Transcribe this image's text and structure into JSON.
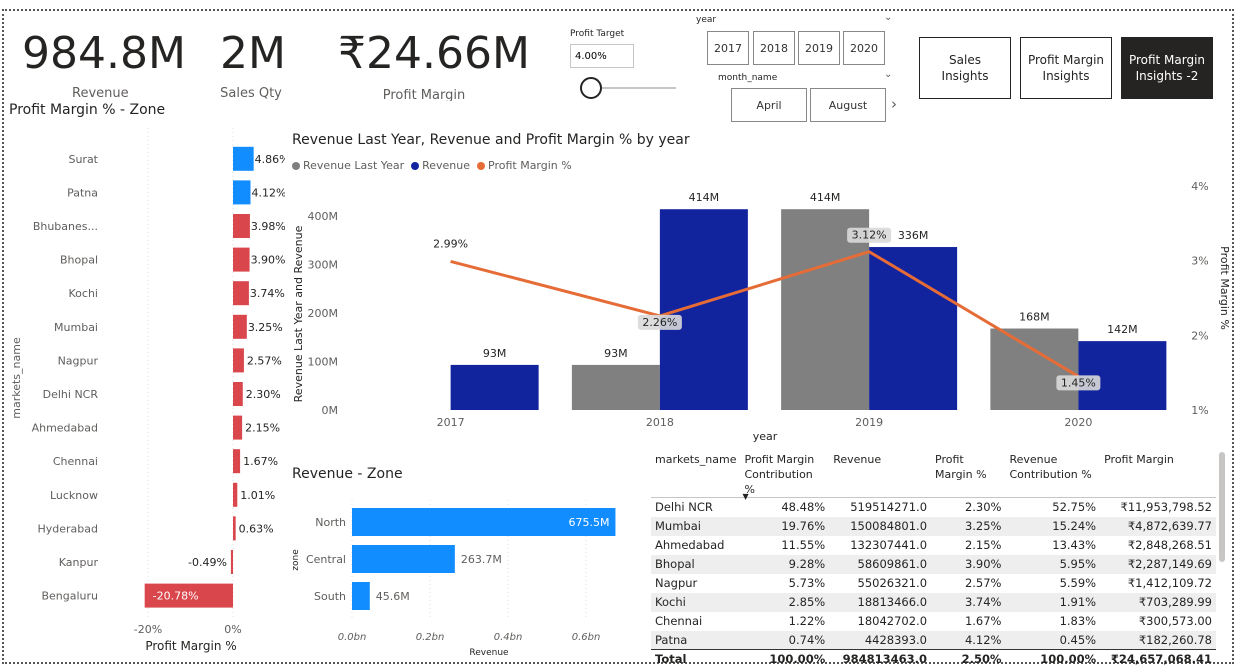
{
  "kpis": [
    {
      "value": "984.8M",
      "label": "Revenue"
    },
    {
      "value": "2M",
      "label": "Sales Qty"
    },
    {
      "value": "₹24.66M",
      "label": "Profit Margin"
    }
  ],
  "profit_target": {
    "label": "Profit Target",
    "value": "4.00%"
  },
  "year_slicer": {
    "label": "year",
    "items": [
      "2017",
      "2018",
      "2019",
      "2020"
    ]
  },
  "month_slicer": {
    "label": "month_name",
    "items": [
      "April",
      "August"
    ]
  },
  "nav_buttons": [
    {
      "label": "Sales Insights"
    },
    {
      "label": "Profit Margin Insights"
    },
    {
      "label": "Profit Margin Insights -2"
    }
  ],
  "colors": {
    "blue": "#118dff",
    "red": "#d9464c",
    "dark_blue": "#12239e",
    "gray": "#808080",
    "orange": "#e66c37",
    "dark_button": "#252423"
  },
  "zone_margin_chart": {
    "title": "Profit Margin % - Zone",
    "y_axis_label": "markets_name",
    "x_axis_label": "Profit Margin %",
    "x_ticks": [
      "-20%",
      "0%"
    ]
  },
  "combo_chart": {
    "title": "Revenue Last Year, Revenue and Profit Margin % by year",
    "legend": [
      "Revenue Last Year",
      "Revenue",
      "Profit Margin %"
    ],
    "y_axis_label": "Revenue Last Year and Revenue",
    "y2_axis_label": "Profit Margin %",
    "x_axis_label": "year",
    "y_ticks": [
      "0M",
      "100M",
      "200M",
      "300M",
      "400M"
    ],
    "y2_ticks": [
      "1%",
      "2%",
      "3%",
      "4%"
    ]
  },
  "revenue_zone_chart": {
    "title": "Revenue - Zone",
    "y_axis_label": "zone",
    "x_axis_label": "Revenue",
    "x_ticks": [
      "0.0bn",
      "0.2bn",
      "0.4bn",
      "0.6bn"
    ]
  },
  "chart_data": [
    {
      "type": "bar",
      "title": "Profit Margin % - Zone",
      "orientation": "horizontal",
      "categories": [
        "Surat",
        "Patna",
        "Bhubanes...",
        "Bhopal",
        "Kochi",
        "Mumbai",
        "Nagpur",
        "Delhi NCR",
        "Ahmedabad",
        "Chennai",
        "Lucknow",
        "Hyderabad",
        "Kanpur",
        "Bengaluru"
      ],
      "values": [
        4.86,
        4.12,
        3.98,
        3.9,
        3.74,
        3.25,
        2.57,
        2.3,
        2.15,
        1.67,
        1.01,
        0.63,
        -0.49,
        -20.78
      ],
      "labels": [
        "4.86%",
        "4.12%",
        "3.98%",
        "3.90%",
        "3.74%",
        "3.25%",
        "2.57%",
        "2.30%",
        "2.15%",
        "1.67%",
        "1.01%",
        "0.63%",
        "-0.49%",
        "-20.78%"
      ],
      "xlabel": "Profit Margin %",
      "ylabel": "markets_name",
      "xlim": [
        -24,
        6
      ]
    },
    {
      "type": "bar",
      "title": "Revenue Last Year, Revenue and Profit Margin % by year",
      "categories": [
        "2017",
        "2018",
        "2019",
        "2020"
      ],
      "series": [
        {
          "name": "Revenue Last Year",
          "values": [
            null,
            93,
            414,
            168
          ],
          "labels": [
            "",
            "93M",
            "414M",
            "168M"
          ]
        },
        {
          "name": "Revenue",
          "values": [
            93,
            414,
            336,
            142
          ],
          "labels": [
            "93M",
            "414M",
            "336M",
            "142M"
          ]
        },
        {
          "name": "Profit Margin %",
          "type": "line",
          "axis": "secondary",
          "values": [
            2.99,
            2.26,
            3.12,
            1.45
          ],
          "labels": [
            "2.99%",
            "2.26%",
            "3.12%",
            "1.45%"
          ]
        }
      ],
      "xlabel": "year",
      "ylabel": "Revenue Last Year and Revenue",
      "y2label": "Profit Margin %",
      "ylim": [
        0,
        450
      ],
      "y2lim": [
        1,
        4
      ]
    },
    {
      "type": "bar",
      "title": "Revenue - Zone",
      "orientation": "horizontal",
      "categories": [
        "North",
        "Central",
        "South"
      ],
      "values": [
        675.5,
        263.7,
        45.6
      ],
      "labels": [
        "675.5M",
        "263.7M",
        "45.6M"
      ],
      "xlabel": "Revenue",
      "ylabel": "zone",
      "xlim": [
        0,
        700
      ]
    }
  ],
  "table": {
    "columns": [
      "markets_name",
      "Profit Margin Contribution %",
      "Revenue",
      "Profit Margin %",
      "Revenue Contribution %",
      "Profit Margin"
    ],
    "rows": [
      [
        "Delhi NCR",
        "48.48%",
        "519514271.0",
        "2.30%",
        "52.75%",
        "₹11,953,798.52"
      ],
      [
        "Mumbai",
        "19.76%",
        "150084801.0",
        "3.25%",
        "15.24%",
        "₹4,872,639.77"
      ],
      [
        "Ahmedabad",
        "11.55%",
        "132307441.0",
        "2.15%",
        "13.43%",
        "₹2,848,268.51"
      ],
      [
        "Bhopal",
        "9.28%",
        "58609861.0",
        "3.90%",
        "5.95%",
        "₹2,287,149.69"
      ],
      [
        "Nagpur",
        "5.73%",
        "55026321.0",
        "2.57%",
        "5.59%",
        "₹1,412,109.72"
      ],
      [
        "Kochi",
        "2.85%",
        "18813466.0",
        "3.74%",
        "1.91%",
        "₹703,289.99"
      ],
      [
        "Chennai",
        "1.22%",
        "18042702.0",
        "1.67%",
        "1.83%",
        "₹300,573.00"
      ],
      [
        "Patna",
        "0.74%",
        "4428393.0",
        "4.12%",
        "0.45%",
        "₹182,260.78"
      ]
    ],
    "total": [
      "Total",
      "100.00%",
      "984813463.0",
      "2.50%",
      "100.00%",
      "₹24,657,068.41"
    ]
  }
}
